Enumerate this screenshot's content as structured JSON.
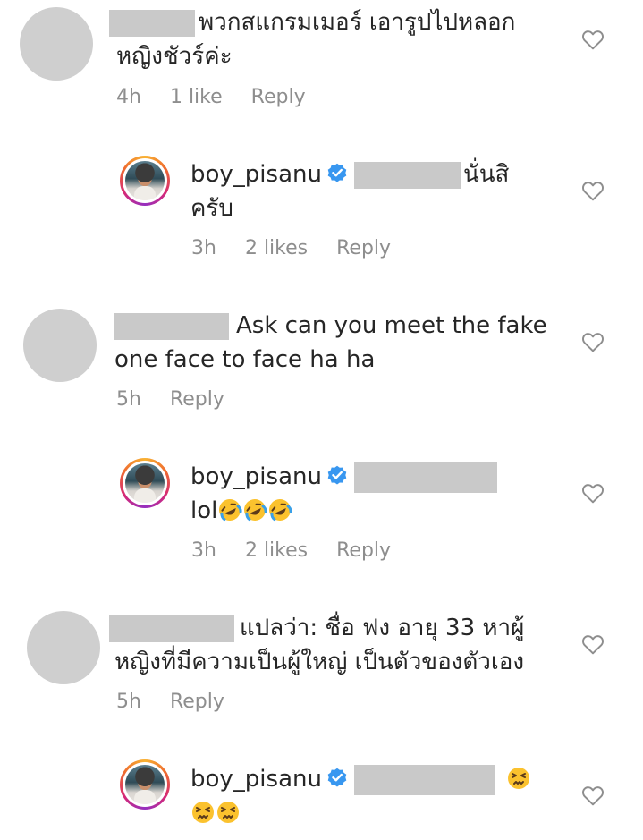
{
  "colors": {
    "text": "#262626",
    "meta": "#8e8e8e",
    "verified": "#3897f0",
    "redacted": "#c9c9c9"
  },
  "comments": [
    {
      "line1": "พวกสแกรมเมอร์ เอารูปไปหลอก",
      "line2": "หญิงชัวร์ค่ะ",
      "time": "4h",
      "likes": "1 like",
      "reply": "Reply"
    },
    {
      "username": "boy_pisanu",
      "line1": "นั่นสิ",
      "line2": "ครับ",
      "time": "3h",
      "likes": "2 likes",
      "reply": "Reply"
    },
    {
      "line1": "Ask  can you meet the fake",
      "line2": "one face to face  ha ha",
      "time": "5h",
      "reply": "Reply"
    },
    {
      "username": "boy_pisanu",
      "line2": "lol",
      "emoji": "rofl-emoji",
      "time": "3h",
      "likes": "2 likes",
      "reply": "Reply"
    },
    {
      "line1": "แปลว่า: ชื่อ ฟง อายุ 33 หาผู้",
      "line2": "หญิงที่มีความเป็นผู้ใหญ่ เป็นตัวของตัวเอง",
      "time": "5h",
      "reply": "Reply"
    },
    {
      "username": "boy_pisanu",
      "emoji": "persevering-face-emoji"
    }
  ],
  "icons": {
    "heart": "heart-outline-icon",
    "verified": "verified-badge-icon"
  }
}
